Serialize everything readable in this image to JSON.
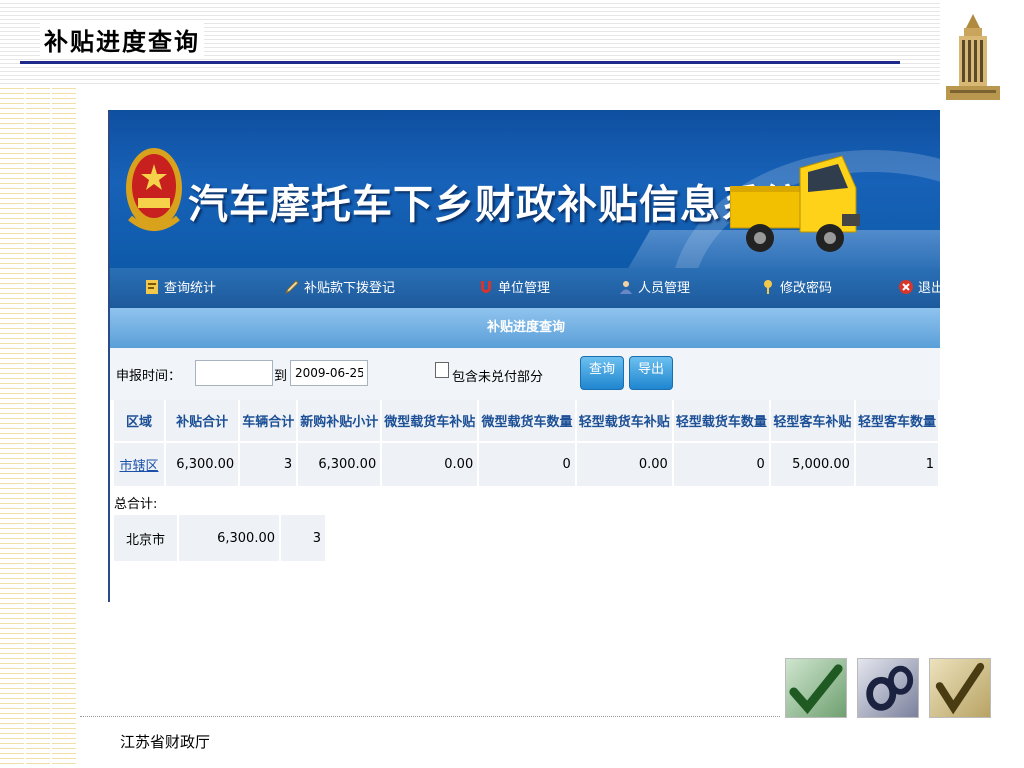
{
  "slide": {
    "title": "补贴进度查询",
    "footer": "江苏省财政厅"
  },
  "app": {
    "banner_title": "汽车摩托车下乡财政补贴信息系统",
    "nav": [
      {
        "label": "查询统计",
        "icon": "report-icon"
      },
      {
        "label": "补贴款下拨登记",
        "icon": "pen-icon"
      },
      {
        "label": "单位管理",
        "icon": "magnet-icon"
      },
      {
        "label": "人员管理",
        "icon": "user-icon"
      },
      {
        "label": "修改密码",
        "icon": "key-icon"
      },
      {
        "label": "退出",
        "icon": "close-icon"
      }
    ],
    "section_title": "补贴进度查询",
    "query": {
      "date_label": "申报时间：",
      "start_value": "",
      "to_label": "到",
      "end_value": "2009-06-25",
      "include_unpaid_label": "包含未兑付部分",
      "query_button": "查询",
      "export_button": "导出"
    },
    "table": {
      "headers": [
        "区域",
        "补贴合计",
        "车辆合计",
        "新购补贴小计",
        "微型载货车补贴",
        "微型载货车数量",
        "轻型载货车补贴",
        "轻型载货车数量",
        "轻型客车补贴",
        "轻型客车数量"
      ],
      "rows": [
        [
          "市辖区",
          "6,300.00",
          "3",
          "6,300.00",
          "0.00",
          "0",
          "0.00",
          "0",
          "5,000.00",
          "1"
        ]
      ]
    },
    "total": {
      "label": "总合计:",
      "row": [
        "北京市",
        "6,300.00",
        "3"
      ]
    }
  },
  "colors": {
    "title_rule": "#1e2a8a",
    "banner": "#1762b8",
    "navbar": "#2a6fb5",
    "header_text": "#1c4f95"
  }
}
